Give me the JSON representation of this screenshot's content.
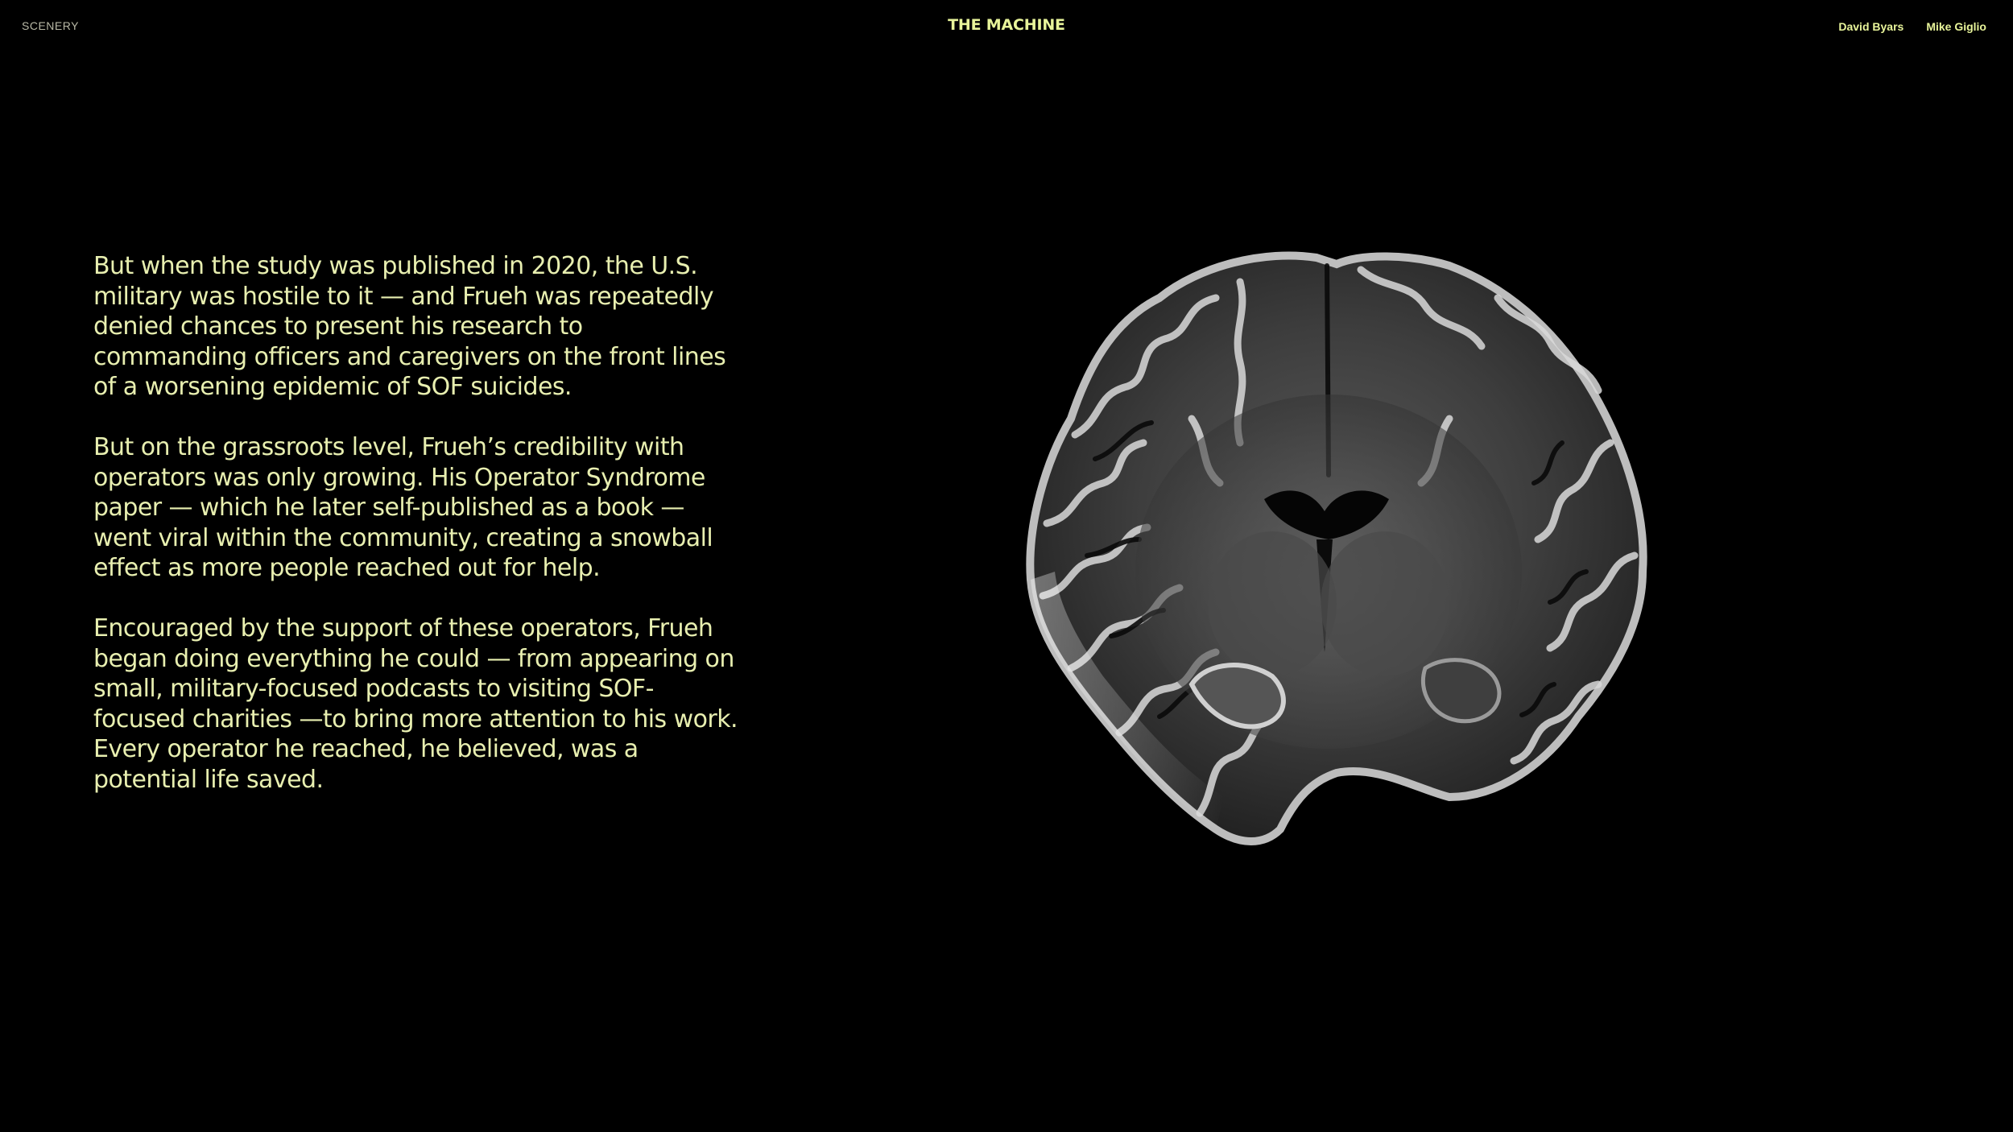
{
  "header": {
    "section_label": "SCENERY",
    "title": "THE MACHINE",
    "authors": [
      "David Byars",
      "Mike Giglio"
    ]
  },
  "article": {
    "paragraphs": [
      "But when the study was published in 2020, the U.S. military was hostile to it — and Frueh was repeatedly denied chances to present his research to commanding officers and caregivers on the front lines of a worsening epidemic of SOF suicides.",
      "But on the grassroots level, Frueh’s credibility with operators was only growing. His Operator Syndrome paper — which he later self-published as a book — went viral within the community, creating a snowball effect as more people reached out for help.",
      "Encouraged by the support of these operators, Frueh began doing everything he could — from appearing on small, military-focused podcasts to visiting SOF-focused charities —to bring more attention to his work. Every operator he reached, he believed, was a potential life saved."
    ]
  },
  "figure": {
    "icon": "brain-scan-image"
  },
  "colors": {
    "background": "#000000",
    "text": "#e8efb0",
    "accent": "#e8f49a",
    "muted": "#b9b9a6"
  }
}
